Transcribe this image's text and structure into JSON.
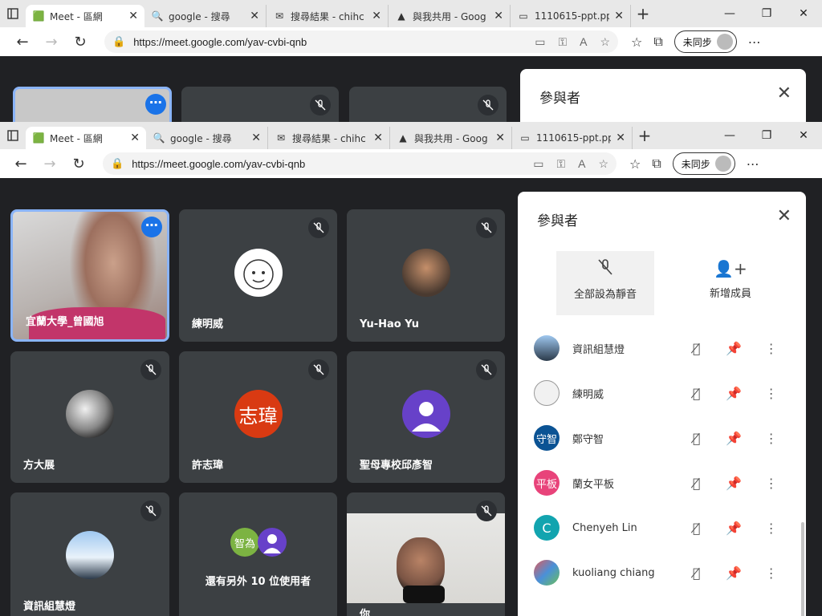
{
  "browser": {
    "tabs": [
      {
        "title": "Meet - 區網",
        "active": true
      },
      {
        "title": "google - 搜尋",
        "active": false
      },
      {
        "title": "搜尋結果 - chihc",
        "active": false
      },
      {
        "title": "與我共用 - Goog",
        "active": false
      },
      {
        "title": "1110615-ppt.ppt",
        "active": false
      }
    ],
    "url": "https://meet.google.com/yav-cvbi-qnb",
    "sync_label": "未同步",
    "window_controls": [
      "—",
      "❐",
      "✕"
    ]
  },
  "meet": {
    "tiles": [
      {
        "name": "宜蘭大學_曾國旭",
        "kind": "video"
      },
      {
        "name": "練明威",
        "kind": "avatar"
      },
      {
        "name": "Yu-Hao Yu",
        "kind": "avatar"
      },
      {
        "name": "方大展",
        "kind": "avatar"
      },
      {
        "name": "許志瑋",
        "kind": "initials",
        "initials": "志瑋"
      },
      {
        "name": "聖母專校邱彥智",
        "kind": "avatar"
      },
      {
        "name": "資訊組慧燈",
        "kind": "avatar"
      },
      {
        "name": "還有另外 10 位使用者",
        "kind": "group",
        "initials": "智為"
      },
      {
        "name": "你",
        "kind": "video"
      }
    ]
  },
  "panel": {
    "title": "參與者",
    "mute_all_label": "全部設為靜音",
    "add_member_label": "新增成員",
    "participants": [
      {
        "name": "資訊組慧燈",
        "initials": "",
        "color": "#5f6368"
      },
      {
        "name": "練明威",
        "initials": "",
        "color": "#f1f1f1"
      },
      {
        "name": "鄭守智",
        "initials": "守智",
        "color": "#0b5394"
      },
      {
        "name": "蘭女平板",
        "initials": "平板",
        "color": "#e8437a"
      },
      {
        "name": "Chenyeh Lin",
        "initials": "C",
        "color": "#12a4af"
      },
      {
        "name": "kuoliang chiang",
        "initials": "",
        "color": "#7b5e57"
      }
    ]
  }
}
